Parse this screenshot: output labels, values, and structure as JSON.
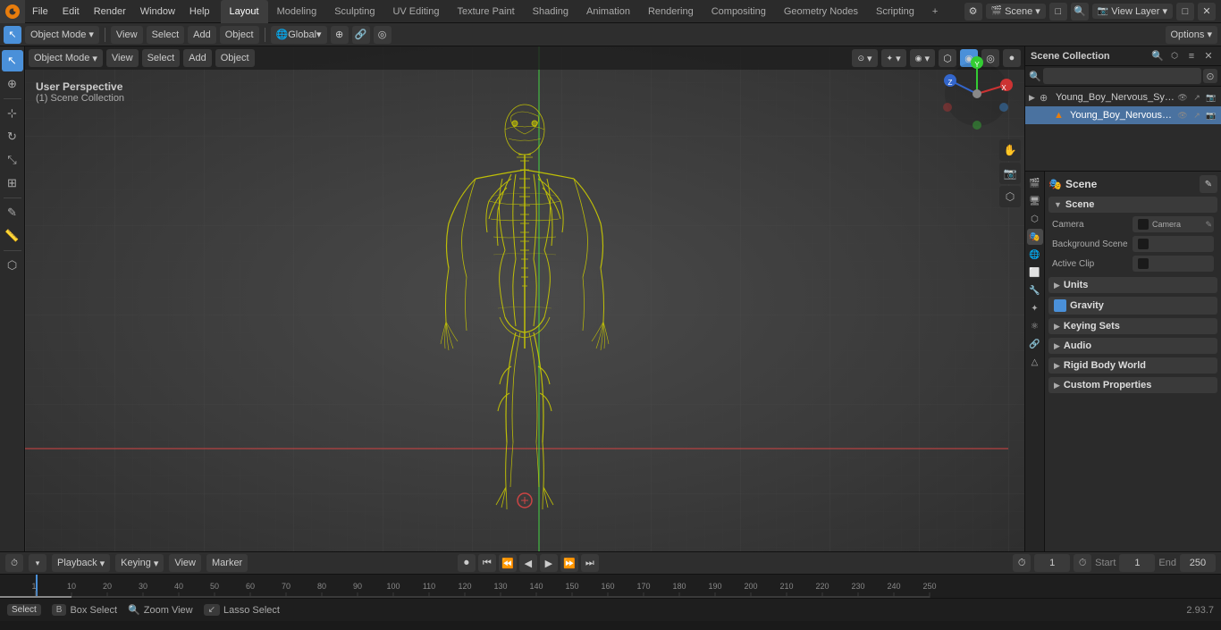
{
  "app": {
    "title": "Blender",
    "version": "2.93.7"
  },
  "top_menu": {
    "logo": "⬟",
    "items": [
      "File",
      "Edit",
      "Render",
      "Window",
      "Help"
    ]
  },
  "workspace_tabs": {
    "tabs": [
      "Layout",
      "Modeling",
      "Sculpting",
      "UV Editing",
      "Texture Paint",
      "Shading",
      "Animation",
      "Rendering",
      "Compositing",
      "Geometry Nodes",
      "Scripting"
    ],
    "active": "Layout",
    "add_label": "+"
  },
  "top_right": {
    "scene_dropdown": "Scene",
    "layer_dropdown": "View Layer"
  },
  "second_toolbar": {
    "object_mode": "Object Mode",
    "view": "View",
    "select": "Select",
    "add": "Add",
    "object": "Object",
    "global_label": "Global",
    "options": "Options ▾"
  },
  "viewport": {
    "overlay_text": "User Perspective",
    "collection_text": "(1) Scene Collection",
    "header_items": [
      "Object Mode",
      "View",
      "Select",
      "Add",
      "Object"
    ]
  },
  "outliner": {
    "title": "Scene Collection",
    "search_placeholder": "",
    "items": [
      {
        "label": "Young_Boy_Nervous_System",
        "icon": "▶",
        "type": "collection",
        "level": 0,
        "expanded": false
      },
      {
        "label": "Young_Boy_Nervous_Syst",
        "icon": "▶",
        "type": "mesh",
        "level": 1,
        "expanded": false
      }
    ]
  },
  "properties": {
    "section_title": "Scene",
    "subsection_title": "Scene",
    "camera_label": "Camera",
    "background_scene_label": "Background Scene",
    "active_clip_label": "Active Clip",
    "prop_icons": [
      "render",
      "output",
      "view_layer",
      "scene",
      "world",
      "object",
      "modifier",
      "particles",
      "physics",
      "constraints",
      "object_data"
    ],
    "gravity_label": "Gravity",
    "gravity_checked": true,
    "units_label": "Units",
    "keying_sets_label": "Keying Sets",
    "audio_label": "Audio",
    "rigid_body_world_label": "Rigid Body World",
    "custom_props_label": "Custom Properties"
  },
  "timeline": {
    "playback_label": "Playback",
    "keying_label": "Keying",
    "view_label": "View",
    "marker_label": "Marker",
    "current_frame": "1",
    "start_label": "Start",
    "start_frame": "1",
    "end_label": "End",
    "end_frame": "250",
    "controls": {
      "jump_start": "⏮",
      "step_back": "⏪",
      "play_back": "◀",
      "play": "▶",
      "step_forward": "⏩",
      "jump_end": "⏭"
    },
    "ruler_marks": [
      "10",
      "20",
      "30",
      "40",
      "50",
      "60",
      "70",
      "80",
      "90",
      "100",
      "110",
      "120",
      "130",
      "140",
      "150",
      "160",
      "170",
      "180",
      "190",
      "200",
      "210",
      "220",
      "230",
      "240",
      "250"
    ]
  },
  "status_bar": {
    "select_key": "Select",
    "box_select_key": "Box Select",
    "zoom_view_key": "Zoom View",
    "lasso_select_key": "Lasso Select",
    "version": "2.93.7"
  }
}
